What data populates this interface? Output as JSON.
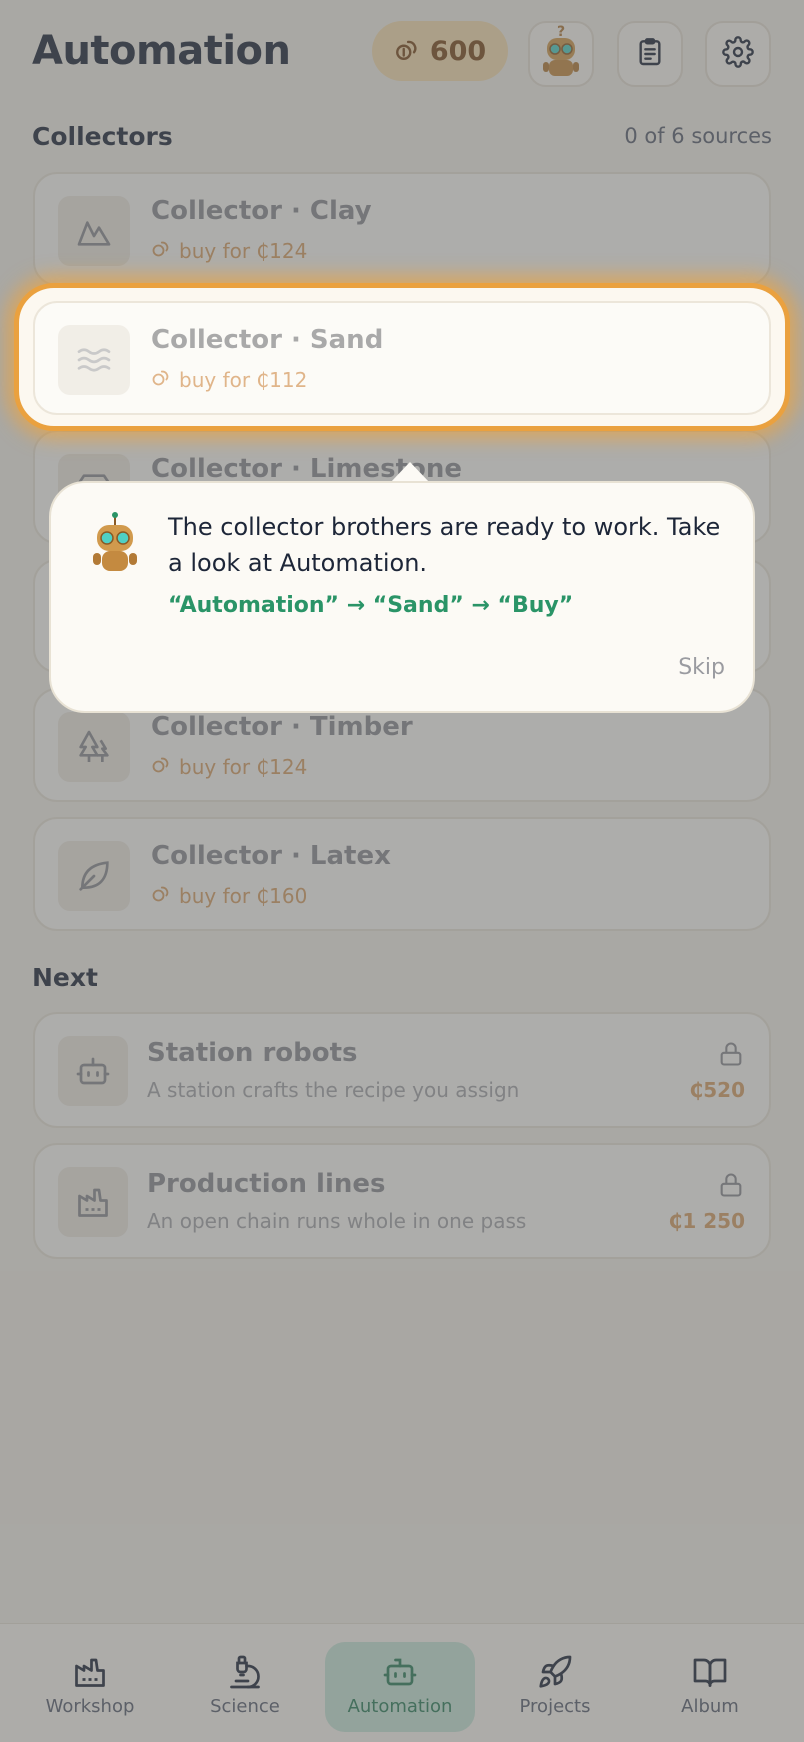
{
  "header": {
    "title": "Automation",
    "coins": "600",
    "icons": [
      "coin-icon",
      "robot-avatar-icon",
      "clipboard-icon",
      "gear-icon"
    ]
  },
  "collectors": {
    "heading": "Collectors",
    "count_text": "0 of 6 sources",
    "items": [
      {
        "title": "Collector · Clay",
        "buy": "buy for ₵124",
        "icon": "mountain-icon"
      },
      {
        "title": "Collector · Sand",
        "buy": "buy for ₵112",
        "icon": "waves-icon"
      },
      {
        "title": "Collector · Limestone",
        "icon": "gem-icon"
      },
      {
        "title": "Collector · Timber",
        "buy": "buy for ₵124",
        "icon": "trees-icon"
      },
      {
        "title": "Collector · Latex",
        "buy": "buy for ₵160",
        "icon": "leaf-icon"
      }
    ]
  },
  "next": {
    "heading": "Next",
    "items": [
      {
        "title": "Station robots",
        "desc": "A station crafts the recipe you assign",
        "price": "₵520",
        "icon": "bot-icon"
      },
      {
        "title": "Production lines",
        "desc": "An open chain runs whole in one pass",
        "price": "₵1 250",
        "icon": "factory-icon"
      }
    ]
  },
  "tooltip": {
    "text": "The collector brothers are ready to work. Take a look at Automation.",
    "path": "“Automation” → “Sand” → “Buy”",
    "skip": "Skip"
  },
  "tabs": [
    {
      "label": "Workshop",
      "icon": "factory-icon"
    },
    {
      "label": "Science",
      "icon": "microscope-icon"
    },
    {
      "label": "Automation",
      "icon": "bot-icon",
      "active": true
    },
    {
      "label": "Projects",
      "icon": "rocket-icon"
    },
    {
      "label": "Album",
      "icon": "book-icon"
    }
  ],
  "colors": {
    "accent_green": "#2a9467",
    "highlight_orange": "#eaa13f",
    "price_tan": "#d6a066",
    "title_navy": "#1d2638"
  }
}
